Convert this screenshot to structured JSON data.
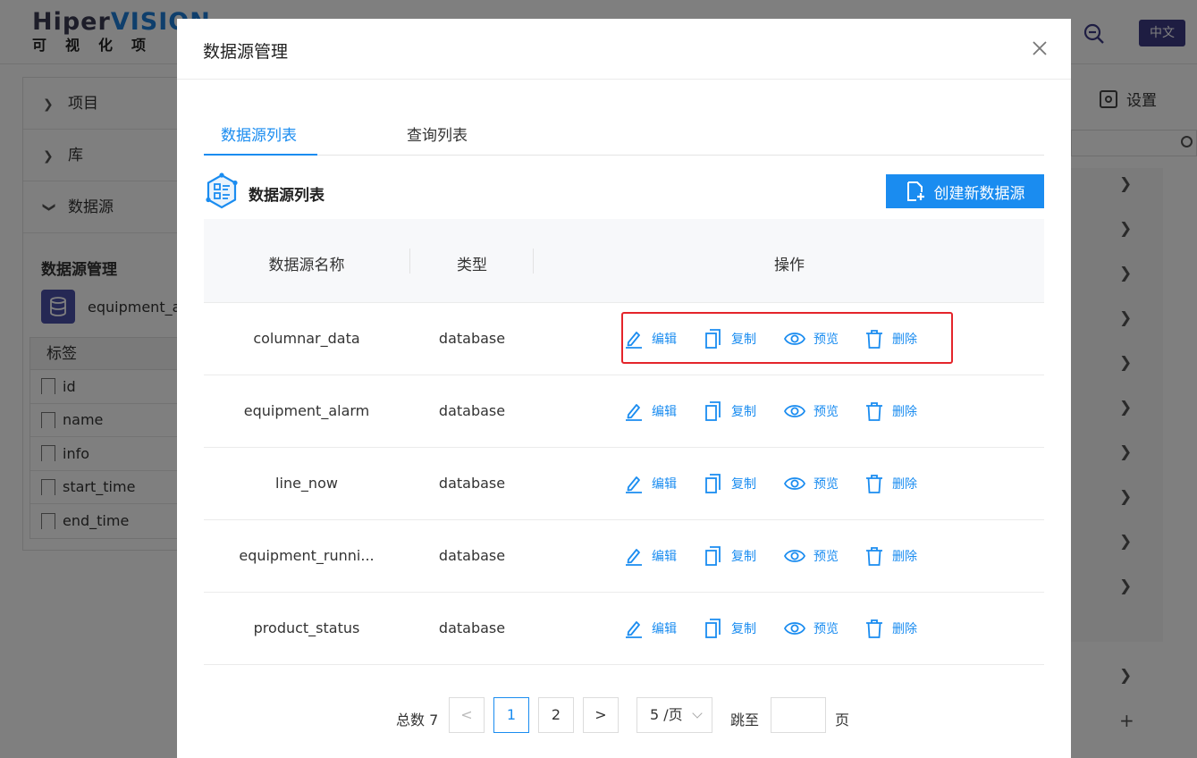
{
  "app": {
    "logo_main_dark": "Hiper",
    "logo_main_blue": "VISION",
    "logo_sub": "可视化项",
    "lang_label": "中文",
    "settings_label": "设置"
  },
  "sidebar": {
    "items": [
      {
        "label": "项目",
        "expanded": false
      },
      {
        "label": "库",
        "expanded": false
      },
      {
        "label": "数据源",
        "expanded": true
      }
    ],
    "section_title": "数据源管理",
    "datasource_name": "equipment_a",
    "field_header": "标签",
    "fields": [
      "id",
      "name",
      "info",
      "start_time",
      "end_time"
    ]
  },
  "modal": {
    "title": "数据源管理",
    "tabs": [
      {
        "label": "数据源列表",
        "active": true
      },
      {
        "label": "查询列表",
        "active": false
      }
    ],
    "section_title": "数据源列表",
    "create_button": "创建新数据源",
    "columns": {
      "name": "数据源名称",
      "type": "类型",
      "actions": "操作"
    },
    "action_labels": {
      "edit": "编辑",
      "copy": "复制",
      "preview": "预览",
      "delete": "删除"
    },
    "rows": [
      {
        "name": "columnar_data",
        "type": "database"
      },
      {
        "name": "equipment_alarm",
        "type": "database"
      },
      {
        "name": "line_now",
        "type": "database"
      },
      {
        "name": "equipment_runni...",
        "type": "database"
      },
      {
        "name": "product_status",
        "type": "database"
      }
    ],
    "pagination": {
      "total_label": "总数 7",
      "prev": "<",
      "pages": [
        "1",
        "2"
      ],
      "current_page": "1",
      "next": ">",
      "page_size": "5 /页",
      "jump_label": "跳至",
      "jump_value": "",
      "page_suffix": "页"
    }
  },
  "colors": {
    "primary": "#1a8cf0",
    "highlight_border": "#e4242a",
    "overlay": "rgba(0,0,0,0.5)",
    "lang_button": "#3d3a85"
  }
}
